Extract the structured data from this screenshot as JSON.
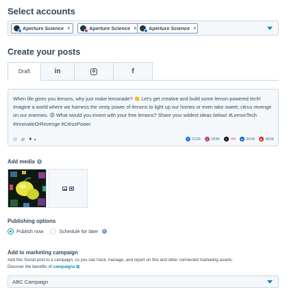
{
  "select_accounts": {
    "title": "Select accounts",
    "chips": [
      {
        "label": "Aperture Science",
        "network": "facebook",
        "color": "#1877f2"
      },
      {
        "label": "Aperture Science",
        "network": "instagram",
        "color": "#c13584"
      },
      {
        "label": "Aperture Science",
        "network": "facebook",
        "color": "#1877f2"
      }
    ],
    "remove_glyph": "×"
  },
  "create_posts": {
    "title": "Create your posts",
    "tabs": [
      {
        "label": "Draft",
        "active": true
      },
      {
        "icon": "linkedin-icon",
        "glyph": "in"
      },
      {
        "icon": "instagram-icon"
      },
      {
        "icon": "facebook-icon",
        "glyph": "f"
      }
    ]
  },
  "editor": {
    "text": "When life gives you lemons, why just make lemonade? 👏 Let's get creative and build some lemon-powered tech! Imagine a world where we harness the zesty power of lemons to light up our homes or even take sweet, citrus revenge on our enemies. 😡 What would you invent with your free lemons? Share your wildest ideas below! #LemonTech #InnovateOrRevenge #CitrusPower",
    "tools": [
      {
        "icon": "emoji-icon",
        "glyph": "☺"
      },
      {
        "icon": "attachment-icon",
        "glyph": "⌀"
      },
      {
        "icon": "sparkle-icon",
        "glyph": "✦"
      }
    ],
    "counts": [
      {
        "network": "facebook",
        "value": "2136",
        "color": "#1877f2",
        "glyph": "f"
      },
      {
        "network": "instagram",
        "value": "1836",
        "color": "#c13584",
        "glyph": "◎"
      },
      {
        "network": "x",
        "value": "-84",
        "color": "#000000",
        "glyph": "X",
        "over_limit": true
      },
      {
        "network": "linkedin",
        "value": "2636",
        "color": "#0a66c2",
        "glyph": "in"
      },
      {
        "network": "youtube",
        "value": "4636",
        "color": "#e62117",
        "glyph": "▶"
      }
    ]
  },
  "media": {
    "label": "Add media",
    "info": "i"
  },
  "publishing": {
    "label": "Publishing options",
    "options": [
      {
        "label": "Publish now",
        "selected": true
      },
      {
        "label": "Schedule for later",
        "selected": false
      }
    ],
    "info": "i"
  },
  "campaign": {
    "label": "Add to marketing campaign",
    "description": "Add this Social post to a campaign, so you can track, manage, and report on this and other connected marketing assets.",
    "discover_prefix": "Discover the benefits of",
    "link": "campaigns",
    "suffix": ".",
    "selected": "ABC Campaign"
  },
  "colors": {
    "accent": "#0091ae",
    "text": "#33475b",
    "border": "#cbd6e2"
  }
}
